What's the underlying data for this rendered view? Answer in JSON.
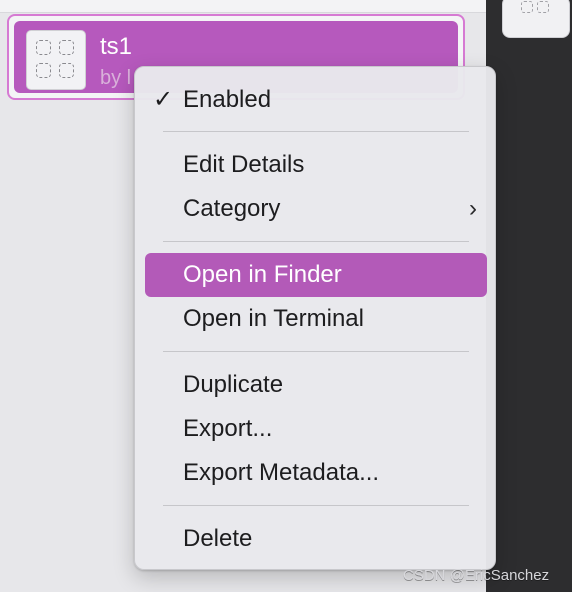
{
  "extension": {
    "name": "ts1",
    "author": "by l"
  },
  "menu": {
    "enabled_checkmark": "✓",
    "items": [
      {
        "label": "Enabled",
        "checked": true
      },
      {
        "label": "Edit Details"
      },
      {
        "label": "Category",
        "submenu_icon": "chevron-right-icon"
      },
      {
        "label": "Open in Finder",
        "highlighted": true
      },
      {
        "label": "Open in Terminal"
      },
      {
        "label": "Duplicate"
      },
      {
        "label": "Export..."
      },
      {
        "label": "Export Metadata..."
      },
      {
        "label": "Delete"
      }
    ],
    "submenu_arrow": "›"
  },
  "watermark": "CSDN @EricSanchez",
  "colors": {
    "accent": "#b35ab8",
    "card_border": "#d67ad3",
    "right_panel": "#2d2d2f"
  }
}
